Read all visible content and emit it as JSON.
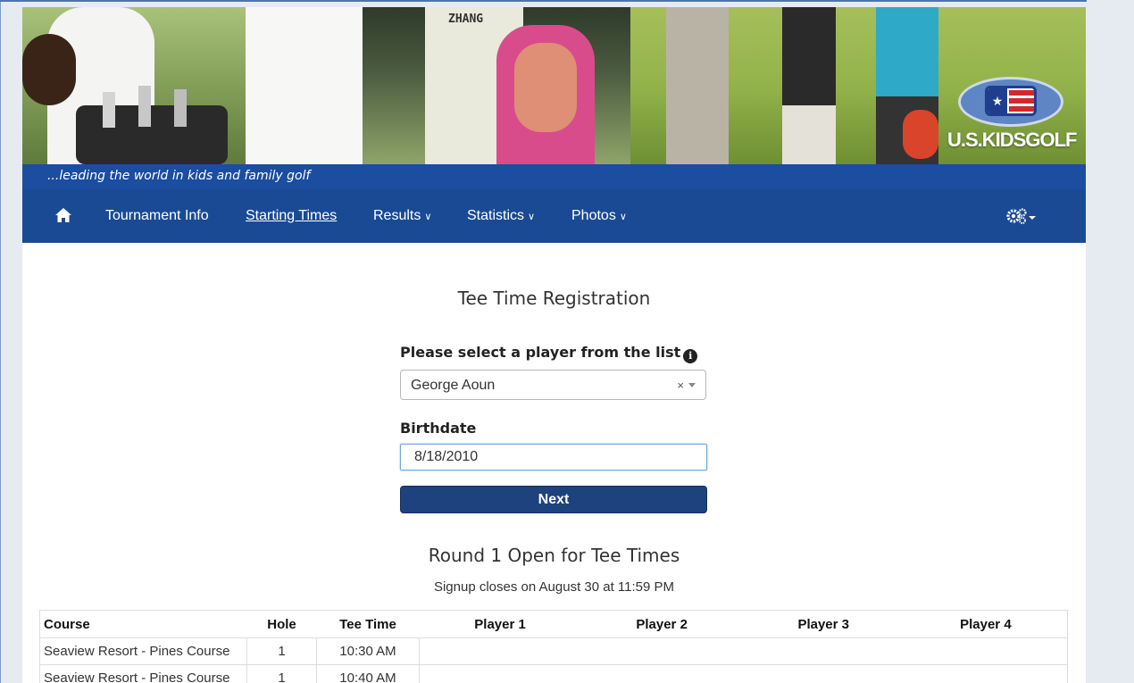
{
  "banner": {
    "photo_jersey_text": "ZHANG",
    "logo_text": "U.S.KIDSGOLF",
    "tagline": "...leading the world in kids and family golf"
  },
  "nav": {
    "items": [
      {
        "label": "Tournament Info",
        "active": false,
        "dropdown": false
      },
      {
        "label": "Starting Times",
        "active": true,
        "dropdown": false
      },
      {
        "label": "Results",
        "active": false,
        "dropdown": true
      },
      {
        "label": "Statistics",
        "active": false,
        "dropdown": true
      },
      {
        "label": "Photos",
        "active": false,
        "dropdown": true
      }
    ],
    "icons": {
      "home": "home-icon",
      "settings": "gears-icon"
    }
  },
  "registration": {
    "title": "Tee Time Registration",
    "player_label": "Please select a player from the list",
    "player_value": "George Aoun",
    "clear_glyph": "×",
    "birthdate_label": "Birthdate",
    "birthdate_value": "8/18/2010",
    "next_label": "Next"
  },
  "round": {
    "title": "Round 1 Open for Tee Times",
    "signup_text": "Signup closes on August 30 at 11:59 PM"
  },
  "table": {
    "headers": [
      "Course",
      "Hole",
      "Tee Time",
      "Player 1",
      "Player 2",
      "Player 3",
      "Player 4"
    ],
    "rows": [
      [
        "Seaview Resort - Pines Course",
        "1",
        "10:30 AM",
        "",
        "",
        "",
        ""
      ],
      [
        "Seaview Resort - Pines Course",
        "1",
        "10:40 AM",
        "",
        "",
        "",
        ""
      ]
    ]
  },
  "colors": {
    "nav_bg": "#1a4a93",
    "tagline_bg": "#1b4da0",
    "button_bg": "#1d427e",
    "page_bg": "#e6ebf1"
  }
}
